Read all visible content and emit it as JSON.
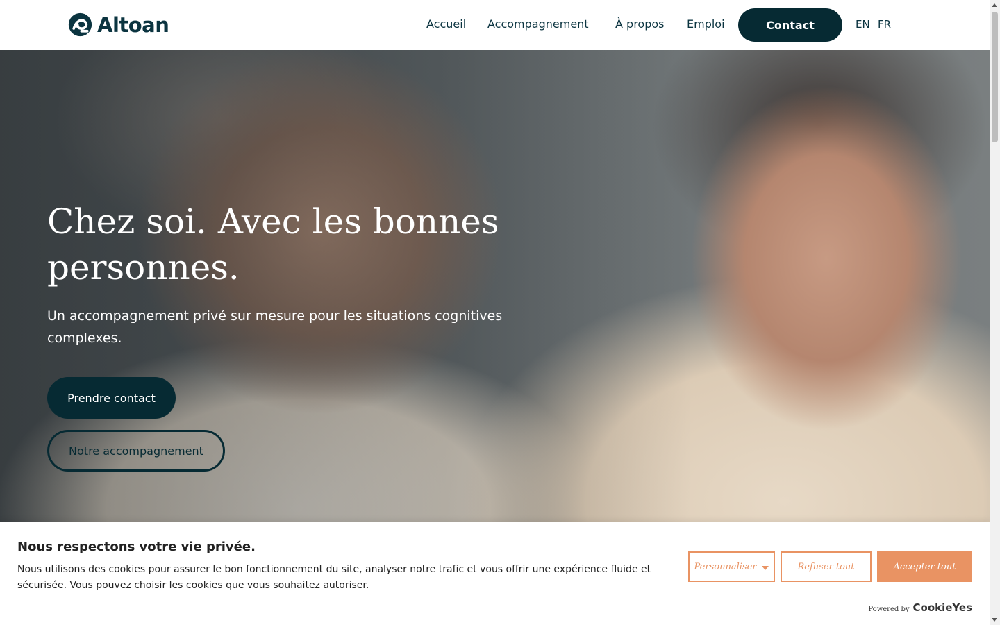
{
  "brand": {
    "name": "Altoan"
  },
  "nav": {
    "items": [
      {
        "label": "Accueil"
      },
      {
        "label": "Accompagnement"
      },
      {
        "label": "À propos"
      },
      {
        "label": "Emploi"
      }
    ],
    "contact_label": "Contact",
    "languages": [
      "EN",
      "FR"
    ]
  },
  "hero": {
    "title_line1": "Chez soi. Avec les bonnes",
    "title_line2": "personnes.",
    "subtitle": "Un accompagnement privé sur mesure pour les situations cognitives complexes.",
    "primary_cta": "Prendre contact",
    "secondary_cta": "Notre accompagnement"
  },
  "cookie": {
    "title": "Nous respectons votre vie privée.",
    "text": "Nous utilisons des cookies pour assurer le bon fonctionnement du site, analyser notre trafic et vous offrir une expérience fluide et sécurisée. Vous pouvez choisir les cookies que vous souhaitez autoriser.",
    "customize_label": "Personnaliser",
    "refuse_label": "Refuser tout",
    "accept_label": "Accepter tout",
    "powered_by": "Powered by",
    "powered_brand": "CookieYes"
  },
  "colors": {
    "primary": "#062a33",
    "accent": "#e99363",
    "text": "#0b3440"
  },
  "icons": {
    "logo": "altoan-logo-mark-icon",
    "customize_caret": "caret-down-icon"
  }
}
